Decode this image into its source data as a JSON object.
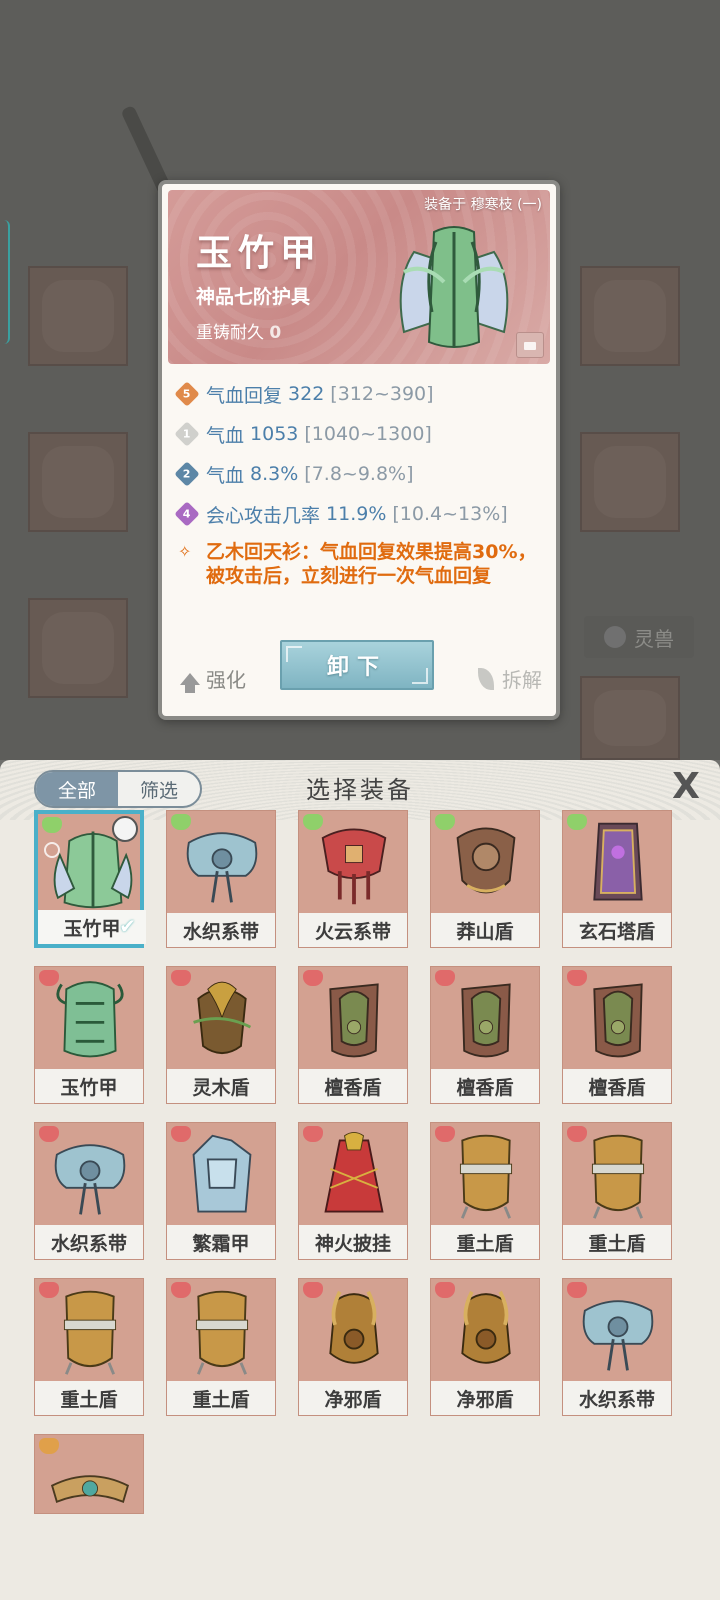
{
  "detail": {
    "equipped_on": "装备于 穆寒枝 (一)",
    "name": "玉竹甲",
    "grade": "神品七阶护具",
    "reforge_label": "重铸耐久",
    "reforge_value": "0",
    "stats": [
      {
        "badge": "5",
        "badge_color": "#e08a4a",
        "name": "气血回复",
        "value": "322",
        "range": "[312~390]"
      },
      {
        "badge": "1",
        "badge_color": "#d0d0cc",
        "name": "气血",
        "value": "1053",
        "range": "[1040~1300]"
      },
      {
        "badge": "2",
        "badge_color": "#5d87a6",
        "name": "气血",
        "value": "8.3%",
        "range": "[7.8~9.8%]"
      },
      {
        "badge": "4",
        "badge_color": "#a96ac2",
        "name": "会心攻击几率",
        "value": "11.9%",
        "range": "[10.4~13%]"
      }
    ],
    "special_text": "乙木回天衫：气血回复效果提高30%，被攻击后，立刻进行一次气血回复",
    "strengthen_label": "强化",
    "unequip_label": "卸下",
    "dismantle_label": "拆解"
  },
  "background": {
    "pet_label": "灵兽"
  },
  "panel": {
    "tab_all": "全部",
    "tab_filter": "筛选",
    "title": "选择装备",
    "close_glyph": "X",
    "items": [
      {
        "name": "玉竹甲",
        "selected": true,
        "quality_color": "#8fd06a",
        "art": "armor-green"
      },
      {
        "name": "水织系带",
        "selected": false,
        "quality_color": "#8fd06a",
        "art": "belt-blue"
      },
      {
        "name": "火云系带",
        "selected": false,
        "quality_color": "#8fd06a",
        "art": "belt-red"
      },
      {
        "name": "莽山盾",
        "selected": false,
        "quality_color": "#8fd06a",
        "art": "shield-brown"
      },
      {
        "name": "玄石塔盾",
        "selected": false,
        "quality_color": "#8fd06a",
        "art": "shield-purple"
      },
      {
        "name": "玉竹甲",
        "selected": false,
        "quality_color": "#e06a6a",
        "art": "armor-green2"
      },
      {
        "name": "灵木盾",
        "selected": false,
        "quality_color": "#e06a6a",
        "art": "shield-wood"
      },
      {
        "name": "檀香盾",
        "selected": false,
        "quality_color": "#e06a6a",
        "art": "shield-sandal"
      },
      {
        "name": "檀香盾",
        "selected": false,
        "quality_color": "#e06a6a",
        "art": "shield-sandal"
      },
      {
        "name": "檀香盾",
        "selected": false,
        "quality_color": "#e06a6a",
        "art": "shield-sandal"
      },
      {
        "name": "水织系带",
        "selected": false,
        "quality_color": "#e06a6a",
        "art": "belt-blue"
      },
      {
        "name": "繁霜甲",
        "selected": false,
        "quality_color": "#e06a6a",
        "art": "armor-ice"
      },
      {
        "name": "神火披挂",
        "selected": false,
        "quality_color": "#e06a6a",
        "art": "cape-red"
      },
      {
        "name": "重土盾",
        "selected": false,
        "quality_color": "#e06a6a",
        "art": "shield-gold"
      },
      {
        "name": "重土盾",
        "selected": false,
        "quality_color": "#e06a6a",
        "art": "shield-gold"
      },
      {
        "name": "重土盾",
        "selected": false,
        "quality_color": "#e06a6a",
        "art": "shield-gold"
      },
      {
        "name": "重土盾",
        "selected": false,
        "quality_color": "#e06a6a",
        "art": "shield-gold"
      },
      {
        "name": "净邪盾",
        "selected": false,
        "quality_color": "#e06a6a",
        "art": "shield-horn"
      },
      {
        "name": "净邪盾",
        "selected": false,
        "quality_color": "#e06a6a",
        "art": "shield-horn"
      },
      {
        "name": "水织系带",
        "selected": false,
        "quality_color": "#e06a6a",
        "art": "belt-blue"
      },
      {
        "name": "",
        "selected": false,
        "quality_color": "#e0a04a",
        "art": "belt-gold"
      }
    ]
  }
}
